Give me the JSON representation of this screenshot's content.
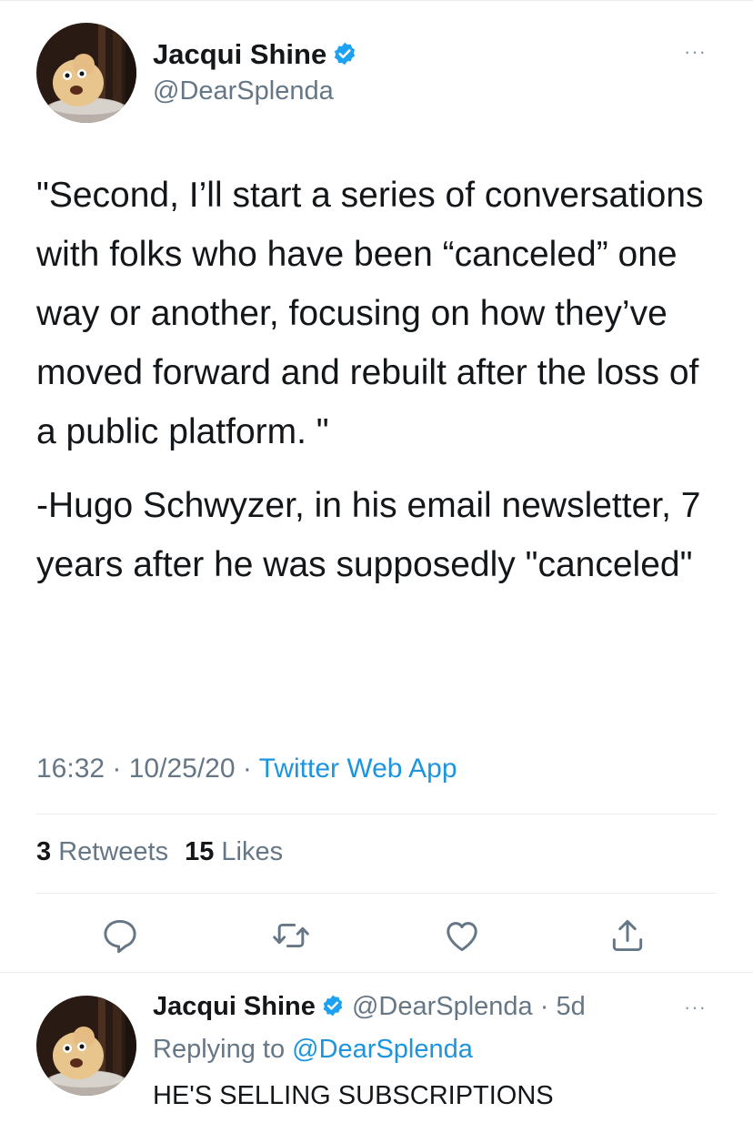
{
  "main_tweet": {
    "author_name": "Jacqui Shine",
    "author_handle": "@DearSplenda",
    "more_label": "···",
    "paragraphs": [
      "\"Second, I’ll start a series of conversations with folks who have been “canceled” one way or another, focusing on how they’ve moved forward and rebuilt after the loss of a public platform. \"",
      "-Hugo Schwyzer, in his email newsletter, 7 years after he was supposedly \"canceled\""
    ],
    "time": "16:32",
    "date": "10/25/20",
    "separator": " · ",
    "source": "Twitter Web App",
    "stats": {
      "retweets_count": "3",
      "retweets_label": "Retweets",
      "likes_count": "15",
      "likes_label": "Likes"
    },
    "actions": [
      "reply-icon",
      "retweet-icon",
      "like-icon",
      "share-icon"
    ]
  },
  "reply_tweet": {
    "author_name": "Jacqui Shine",
    "author_handle": "@DearSplenda",
    "age": "5d",
    "separator": " · ",
    "more_label": "···",
    "replying_prefix": "Replying to ",
    "replying_to": "@DearSplenda",
    "text": "HE'S SELLING SUBSCRIPTIONS"
  },
  "colors": {
    "accent": "#1b95e0",
    "text": "#14171a",
    "secondary": "#657786",
    "divider": "#e6ecf0",
    "verified": "#1da1f2"
  }
}
